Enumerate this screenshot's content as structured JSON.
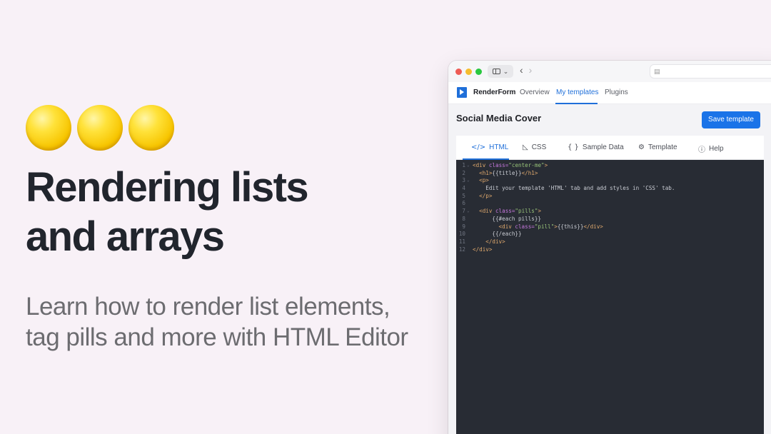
{
  "hero": {
    "emoji_count": 3,
    "headline_lines": [
      "Rendering lists",
      "and arrays"
    ],
    "subline_lines": [
      "Learn how to render list elements,",
      "tag pills and more with HTML Editor"
    ]
  },
  "app": {
    "brand": "RenderForm",
    "nav": [
      {
        "label": "Overview",
        "active": false
      },
      {
        "label": "My templates",
        "active": true
      },
      {
        "label": "Plugins",
        "active": false
      }
    ],
    "page_title": "Social Media Cover",
    "save_label": "Save template",
    "tabs": [
      {
        "label": "HTML",
        "icon": "code-icon",
        "glyph": "</>",
        "active": true
      },
      {
        "label": "CSS",
        "icon": "ruler-icon",
        "glyph": "◺",
        "active": false
      },
      {
        "label": "Sample Data",
        "icon": "braces-icon",
        "glyph": "{ }",
        "active": false
      },
      {
        "label": "Template",
        "icon": "gear-icon",
        "glyph": "⚙",
        "active": false
      },
      {
        "label": "Help",
        "icon": "info-icon",
        "glyph": "ⓘ",
        "active": false
      }
    ]
  },
  "code_lines": [
    {
      "n": "1",
      "fold": true,
      "indent": 0,
      "parts": [
        [
          "tag",
          "<div "
        ],
        [
          "attr",
          "class="
        ],
        [
          "str",
          "\"center-me\""
        ],
        [
          "tag",
          ">"
        ]
      ]
    },
    {
      "n": "2",
      "fold": false,
      "indent": 2,
      "parts": [
        [
          "tag",
          "<h1>"
        ],
        [
          "txt",
          "{{title}}"
        ],
        [
          "tag",
          "</h1>"
        ]
      ]
    },
    {
      "n": "3",
      "fold": true,
      "indent": 2,
      "parts": [
        [
          "tag",
          "<p>"
        ]
      ]
    },
    {
      "n": "4",
      "fold": false,
      "indent": 4,
      "parts": [
        [
          "txt",
          "Edit your template 'HTML' tab and add styles in 'CSS' tab."
        ]
      ]
    },
    {
      "n": "5",
      "fold": false,
      "indent": 2,
      "parts": [
        [
          "tag",
          "</p>"
        ]
      ]
    },
    {
      "n": "6",
      "fold": false,
      "indent": 0,
      "parts": []
    },
    {
      "n": "7",
      "fold": true,
      "indent": 2,
      "parts": [
        [
          "tag",
          "<div "
        ],
        [
          "attr",
          "class="
        ],
        [
          "str",
          "\"pills\""
        ],
        [
          "tag",
          ">"
        ]
      ]
    },
    {
      "n": "8",
      "fold": false,
      "indent": 6,
      "parts": [
        [
          "txt",
          "{{#each pills}}"
        ]
      ]
    },
    {
      "n": "9",
      "fold": false,
      "indent": 8,
      "parts": [
        [
          "tag",
          "<div "
        ],
        [
          "attr",
          "class="
        ],
        [
          "str",
          "\"pill\""
        ],
        [
          "tag",
          ">"
        ],
        [
          "txt",
          "{{this}}"
        ],
        [
          "tag",
          "</div>"
        ]
      ]
    },
    {
      "n": "10",
      "fold": false,
      "indent": 6,
      "parts": [
        [
          "txt",
          "{{/each}}"
        ]
      ]
    },
    {
      "n": "11",
      "fold": false,
      "indent": 4,
      "parts": [
        [
          "tag",
          "</div>"
        ]
      ]
    },
    {
      "n": "12",
      "fold": false,
      "indent": 0,
      "parts": [
        [
          "tag",
          "</div>"
        ]
      ]
    }
  ]
}
